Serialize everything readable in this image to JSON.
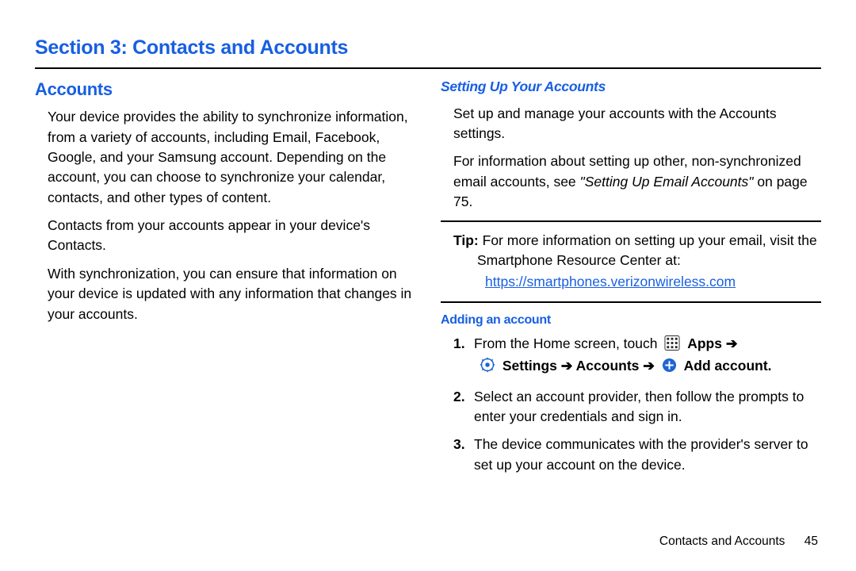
{
  "section_title": "Section 3: Contacts and Accounts",
  "left": {
    "heading": "Accounts",
    "p1": "Your device provides the ability to synchronize information, from a variety of accounts, including Email, Facebook, Google, and your Samsung account. Depending on the account, you can choose to synchronize your calendar, contacts, and other types of content.",
    "p2": "Contacts from your accounts appear in your device's Contacts.",
    "p3": "With synchronization, you can ensure that information on your device is updated with any information that changes in your accounts."
  },
  "right": {
    "sub_heading": "Setting Up Your Accounts",
    "p1": "Set up and manage your accounts with the Accounts settings.",
    "p2a": "For information about setting up other, non-synchronized email accounts, see ",
    "p2_ref": "\"Setting Up Email Accounts\"",
    "p2b": " on page 75.",
    "tip_label": "Tip:",
    "tip_text1": " For more information on setting up your email, visit the",
    "tip_text2": "Smartphone Resource Center at:",
    "tip_link": "https://smartphones.verizonwireless.com",
    "adding_heading": "Adding an account",
    "steps": {
      "s1_a": "From the Home screen, touch ",
      "s1_apps": "Apps",
      "arrow": " ➔ ",
      "s1_settings": "Settings",
      "s1_accounts": "Accounts",
      "s1_addaccount": "Add account",
      "s2": "Select an account provider, then follow the prompts to enter your credentials and sign in.",
      "s3": "The device communicates with the provider's server to set up your account on the device."
    }
  },
  "footer": {
    "chapter": "Contacts and Accounts",
    "page": "45"
  }
}
